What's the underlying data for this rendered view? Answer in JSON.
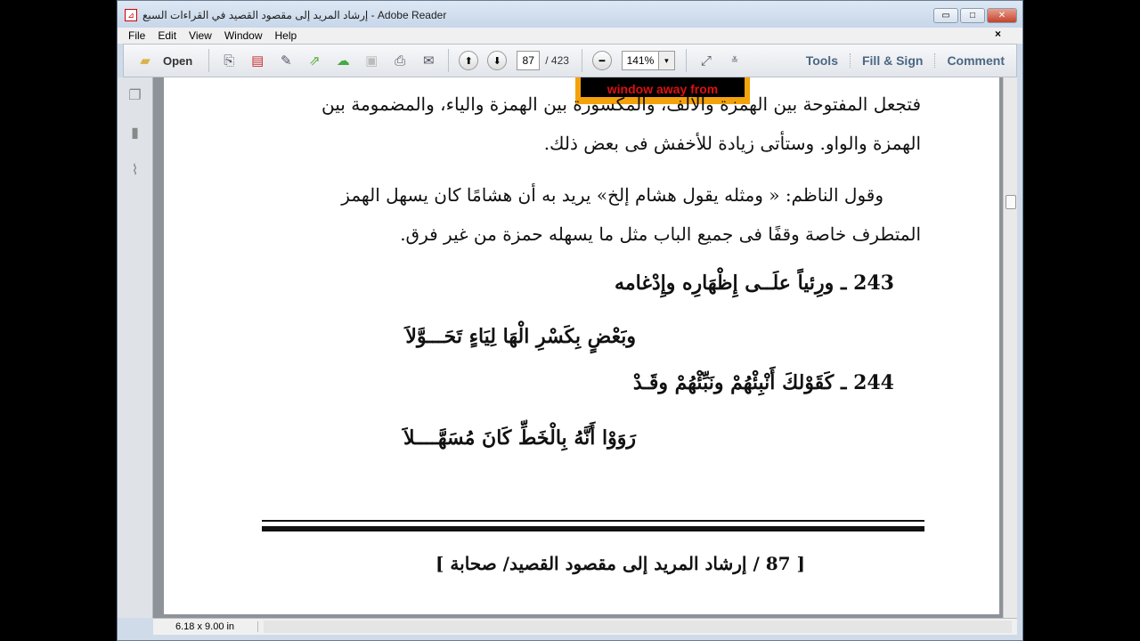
{
  "window": {
    "title": "إرشاد المريد إلى مقصود القصيد في القراءات السبع - Adobe Reader",
    "min": "▭",
    "max": "□",
    "close": "✕"
  },
  "menu": [
    "File",
    "Edit",
    "View",
    "Window",
    "Help"
  ],
  "menu_close": "×",
  "toolbar": {
    "open": "Open",
    "page_current": "87",
    "page_total": "/ 423",
    "zoom": "141%",
    "zoom_arrow": "▾",
    "tools": "Tools",
    "fill_sign": "Fill & Sign",
    "comment": "Comment"
  },
  "overlay_text": "window away from",
  "page": {
    "lines": [
      "فتجعل المفتوحة بين الهمزة والألف، والمكسورة بين الهمزة والياء، والمضمومة بين",
      "الهمزة والواو. وستأتى زيادة للأخفش فى بعض ذلك.",
      "وقول الناظم: « ومثله يقول هشام إلخ» يريد به أن هشامًا كان يسهل الهمز",
      "المتطرف خاصة وقفًا فى جميع الباب مثل ما يسهله حمزة من غير فرق."
    ],
    "verses": [
      "243 ـ ورِئياً علَــى إِظْهَارِه وإِدْغامه",
      "وبَعْضٍ بِكَسْرِ الْهَا لِيَاءٍ تَحَـــوَّلاَ",
      "244 ـ كَقَوْلكَ أَنْبِئْهُمْ ونَبِّئْهُمْ وقَـدْ",
      "رَوَوْا أَنَّهُ بِالْخَطِّ كَانَ مُسَهَّــــلاَ"
    ],
    "footer": "[ 87 / إرشاد المريد إلى مقصود القصيد/ صحابة ]"
  },
  "status": {
    "page_size": "6.18 x 9.00 in"
  }
}
